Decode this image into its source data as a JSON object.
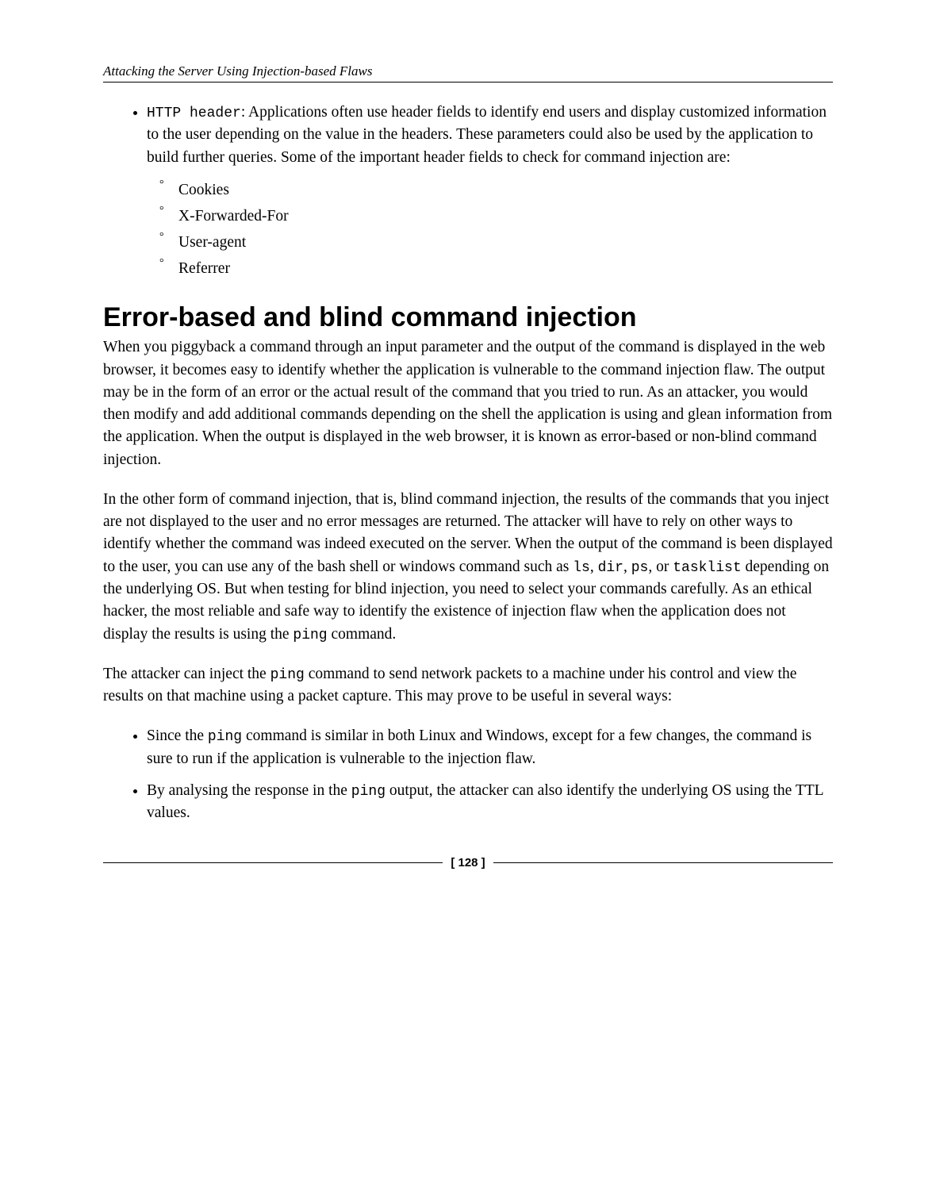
{
  "header": {
    "running_title": "Attacking the Server Using Injection-based Flaws"
  },
  "top_list": {
    "item_code": "HTTP header",
    "item_text": ": Applications often use header fields to identify end users and display customized information to the user depending on the value in the headers. These parameters could also be used by the application to build further queries. Some of the important header fields to check for command injection are:",
    "sub_items": [
      "Cookies",
      "X-Forwarded-For",
      "User-agent",
      "Referrer"
    ]
  },
  "section_heading": "Error-based and blind command injection",
  "para1": "When you piggyback a command through an input parameter and the output of the command is displayed in the web browser, it becomes easy to identify whether the application is vulnerable to the command injection flaw. The output may be in the form of an error or the actual result of the command that you tried to run. As an attacker, you would then modify and add additional commands depending on the shell the application is using and glean information from the application. When the output is displayed in the web browser, it is known as error-based or non-blind command injection.",
  "para2_a": "In the other form of command injection, that is, blind command injection, the results of the commands that you inject are not displayed to the user and no error messages are returned. The attacker will have to rely on other ways to identify whether the command was indeed executed on the server. When the output of the command is been displayed to the user, you can use any of the bash shell or windows command such as ",
  "para2_code1": "ls",
  "para2_b": ", ",
  "para2_code2": "dir",
  "para2_c": ", ",
  "para2_code3": "ps",
  "para2_d": ", or ",
  "para2_code4": "tasklist",
  "para2_e": " depending on the underlying OS. But when testing for blind injection, you need to select your commands carefully. As an ethical hacker, the most reliable and safe way to identify the existence of injection flaw when the application does not display the results is using the ",
  "para2_code5": "ping",
  "para2_f": " command.",
  "para3_a": "The attacker can inject the ",
  "para3_code1": "ping",
  "para3_b": " command to send network packets to a machine under his control and view the results on that machine using a packet capture. This may prove to be useful in several ways:",
  "bullets": {
    "b1_a": "Since the ",
    "b1_code": "ping",
    "b1_b": " command is similar in both Linux and Windows, except for a few changes, the command is sure to run if the application is vulnerable to the injection flaw.",
    "b2_a": "By analysing the response in the ",
    "b2_code": "ping",
    "b2_b": " output, the attacker can also identify the underlying OS using the TTL values."
  },
  "footer": {
    "page": "[ 128 ]"
  }
}
